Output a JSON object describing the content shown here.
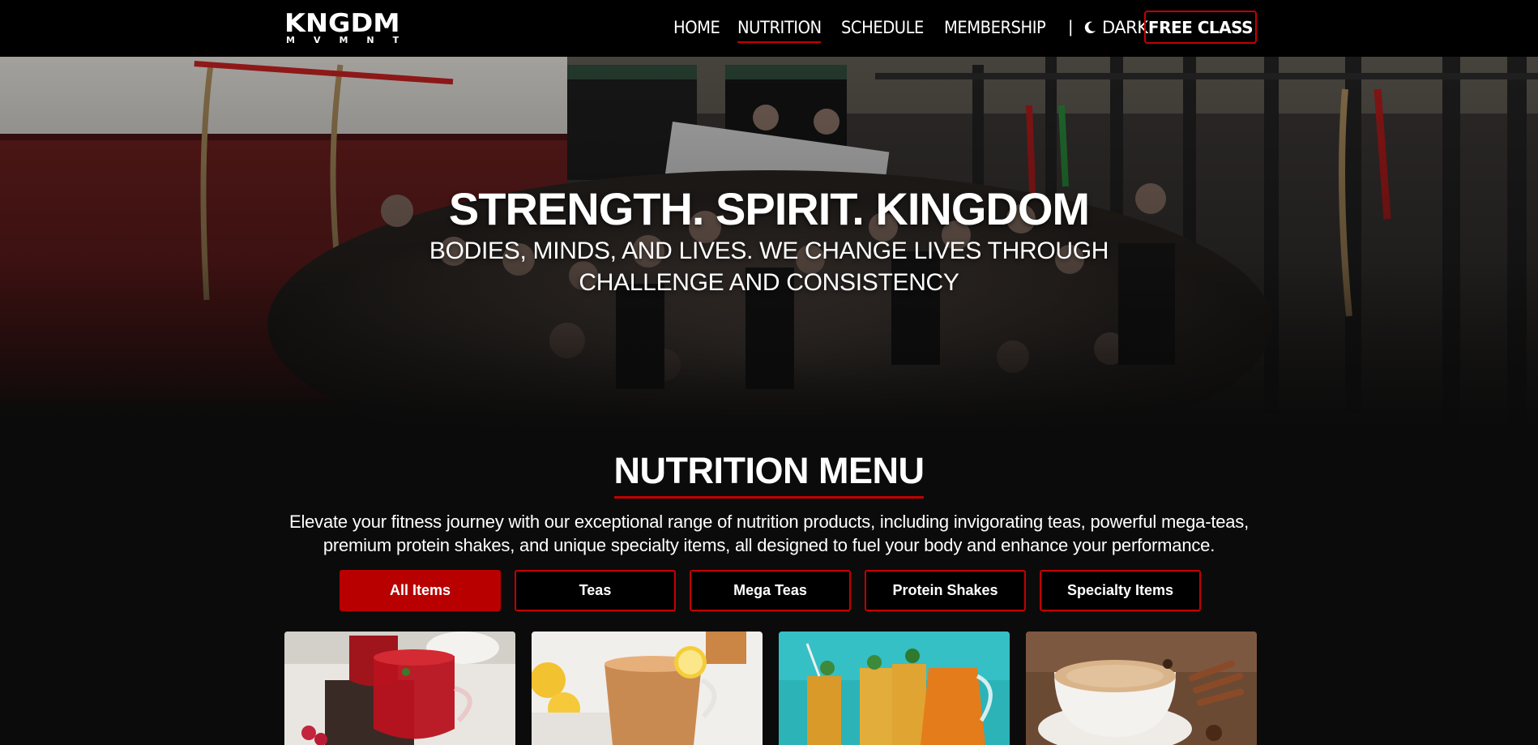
{
  "brand": {
    "logo_main": "KNGDM",
    "logo_sub": "MVMNT"
  },
  "nav": {
    "links": [
      "HOME",
      "NUTRITION",
      "SCHEDULE",
      "MEMBERSHIP"
    ],
    "active": "NUTRITION",
    "separator": "|",
    "dark_label": "DARK",
    "dark_icon": "moon-icon",
    "cta_label": "FREE CLASS"
  },
  "hero": {
    "title": "STRENGTH. SPIRIT. KINGDOM",
    "subtitle": "BODIES, MINDS, AND LIVES. WE CHANGE LIVES THROUGH CHALLENGE AND CONSISTENCY"
  },
  "nutrition": {
    "title": "NUTRITION MENU",
    "description": "Elevate your fitness journey with our exceptional range of nutrition products, including invigorating teas, powerful mega-teas, premium protein shakes, and unique specialty items, all designed to fuel your body and enhance your performance.",
    "filters": [
      "All Items",
      "Teas",
      "Mega Teas",
      "Protein Shakes",
      "Specialty Items"
    ],
    "active_filter": "All Items",
    "cards": [
      {
        "image": "red-berry-tea-photo"
      },
      {
        "image": "lemon-tea-photo"
      },
      {
        "image": "iced-mega-tea-photo"
      },
      {
        "image": "chai-latte-photo"
      }
    ]
  },
  "colors": {
    "accent": "#c40000",
    "background": "#0b0b0b",
    "navbar": "#000000"
  }
}
